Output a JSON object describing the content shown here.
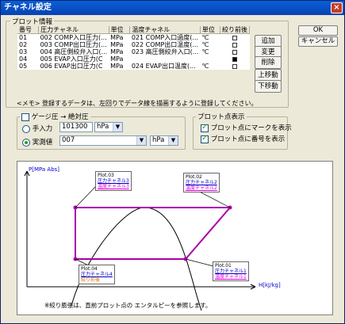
{
  "window": {
    "title": "チャネル設定",
    "close": "×"
  },
  "buttons": {
    "ok": "OK",
    "cancel": "キャンセル",
    "add": "追加",
    "change": "変更",
    "delete": "削除",
    "move_up": "上移動",
    "move_down": "下移動"
  },
  "plot_info": {
    "label": "プロット情報",
    "columns": [
      "番号",
      "圧力チャネル",
      "単位",
      "温度チャネル",
      "単位",
      "絞り前後"
    ],
    "rows": [
      {
        "no": "01",
        "p_ch": "002 COMP入口圧力(...",
        "p_unit": "MPa",
        "t_ch": "021 COMP入口過度(...",
        "t_unit": "℃",
        "flag": false
      },
      {
        "no": "02",
        "p_ch": "003 COMP出口圧力(...",
        "p_unit": "MPa",
        "t_ch": "022 COMP出口温度(...",
        "t_unit": "℃",
        "flag": false
      },
      {
        "no": "03",
        "p_ch": "004 高圧側絞弁入口(...",
        "p_unit": "MPa",
        "t_ch": "023 高圧側絞弁入口(...",
        "t_unit": "℃",
        "flag": false
      },
      {
        "no": "04",
        "p_ch": "005 EVAP入口圧力(C",
        "p_unit": "MPa",
        "t_ch": "",
        "t_unit": "",
        "flag": true
      },
      {
        "no": "05",
        "p_ch": "006 EVAP出口圧力(C",
        "p_unit": "MPa",
        "t_ch": "024 EVAP出口温度(...",
        "t_unit": "℃",
        "flag": false
      }
    ],
    "memo": "<メモ> 登録するデータは、左回りでデータ線を描画するように登録してください。"
  },
  "gauge": {
    "checkbox_label": "ゲージ圧 → 絶対圧",
    "manual_label": "手入力",
    "manual_value": "101300",
    "manual_unit": "hPa",
    "measured_label": "実測値",
    "measured_value": "007",
    "measured_unit": "hPa"
  },
  "plot_display": {
    "label": "プロット点表示",
    "mark_label": "プロット点にマークを表示",
    "number_label": "プロット点に番号を表示"
  },
  "diagram": {
    "y_axis": "P[MPa Abs]",
    "x_axis": "H[kJ/kg]",
    "note": "※絞り膨張は、直前プロット点の エンタルピーを参照します。",
    "points": [
      {
        "title": "Plot.03",
        "p": "圧力チャネル3",
        "t": "温度チャネル3"
      },
      {
        "title": "Plot.02",
        "p": "圧力チャネル2",
        "t": "温度チャネル2"
      },
      {
        "title": "Plot.04",
        "p": "圧力チャネル4",
        "t": "絞り前後"
      },
      {
        "title": "Plot.01",
        "p": "圧力チャネル1",
        "t": "温度チャネル1"
      }
    ]
  }
}
